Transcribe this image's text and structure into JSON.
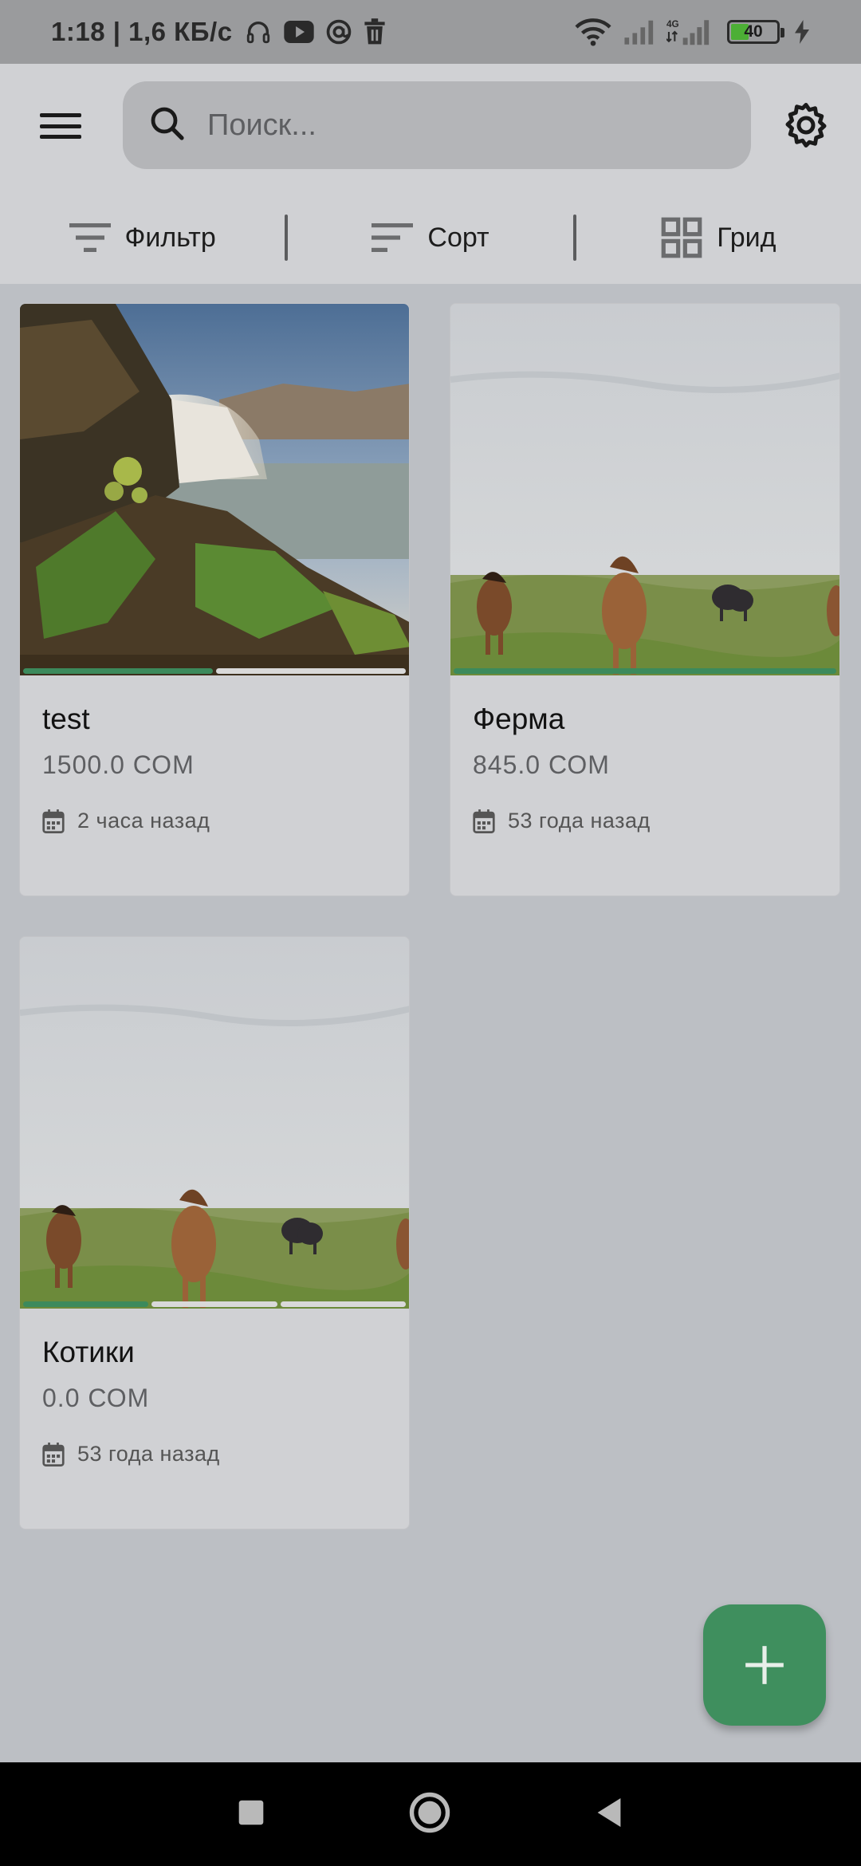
{
  "status_bar": {
    "time_speed": "1:18 | 1,6 КБ/с",
    "battery": "40",
    "network": "4G"
  },
  "header": {
    "search_placeholder": "Поиск...",
    "filter_label": "Фильтр",
    "sort_label": "Сорт",
    "view_label": "Грид"
  },
  "items": [
    {
      "title": "test",
      "price": "1500.0 СОМ",
      "date": "2 часа назад",
      "progress_segments": 2,
      "active_segment": 0,
      "image": "waterfall"
    },
    {
      "title": "Ферма",
      "price": "845.0 СОМ",
      "date": "53 года назад",
      "progress_segments": 1,
      "active_segment": 0,
      "image": "horses"
    },
    {
      "title": "Котики",
      "price": "0.0 СОМ",
      "date": "53 года назад",
      "progress_segments": 3,
      "active_segment": 0,
      "image": "horses"
    }
  ],
  "colors": {
    "accent": "#3f8f5e",
    "progress_active": "#3c8a5c",
    "background": "#bcbfc4",
    "header_bg": "#d0d1d4"
  },
  "icons": {
    "menu": "menu-icon",
    "search": "search-icon",
    "settings": "gear-icon",
    "filter": "filter-icon",
    "sort": "sort-icon",
    "grid": "grid-icon",
    "calendar": "calendar-icon",
    "add": "plus-icon"
  }
}
